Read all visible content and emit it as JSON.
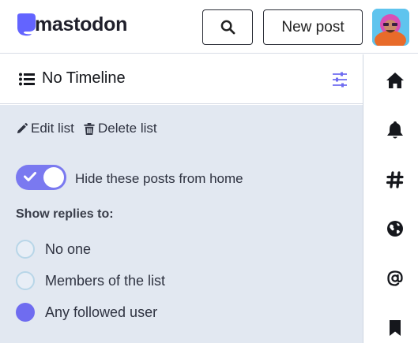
{
  "header": {
    "logo_text": "mastodon",
    "search_icon": "search-icon",
    "new_post_label": "New post",
    "avatar_icon": "avatar"
  },
  "column": {
    "icon": "list-icon",
    "title": "No Timeline",
    "settings_icon": "sliders-icon"
  },
  "settings": {
    "edit_label": "Edit list",
    "edit_icon": "pencil-icon",
    "delete_label": "Delete list",
    "delete_icon": "trash-icon",
    "hide_toggle": {
      "label": "Hide these posts from home",
      "checked": true
    },
    "replies_heading": "Show replies to:",
    "reply_options": [
      {
        "label": "No one",
        "selected": false
      },
      {
        "label": "Members of the list",
        "selected": false
      },
      {
        "label": "Any followed user",
        "selected": true
      }
    ]
  },
  "nav": [
    {
      "name": "home-icon"
    },
    {
      "name": "bell-icon"
    },
    {
      "name": "hashtag-icon"
    },
    {
      "name": "globe-icon"
    },
    {
      "name": "at-icon"
    },
    {
      "name": "bookmark-icon"
    }
  ],
  "colors": {
    "accent": "#6f6cf0",
    "panel_bg": "#e2e8f1",
    "text": "#2e3240"
  }
}
